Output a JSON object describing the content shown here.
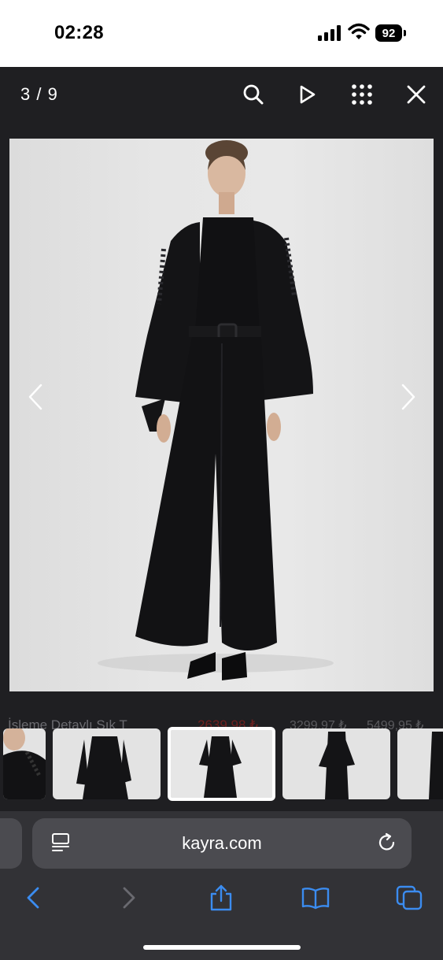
{
  "status_bar": {
    "time": "02:28",
    "battery": "92"
  },
  "gallery": {
    "counter": "3 / 9",
    "icons": [
      "search-icon",
      "play-icon",
      "grid-icon",
      "close-icon",
      "chevron-left-icon",
      "chevron-right-icon"
    ]
  },
  "below_gallery": {
    "title_fragment": "İşleme Detaylı Şık T",
    "sale_price_fragment": "2639,98 ₺",
    "price_a_fragment": "3299,97 ₺",
    "price_b_fragment": "5499,95 ₺"
  },
  "thumbnails": {
    "count": 5,
    "active_index": 2
  },
  "safari": {
    "url": "kayra.com",
    "icons": [
      "reader-icon",
      "reload-icon",
      "back-icon",
      "forward-icon",
      "share-icon",
      "bookmarks-icon",
      "tabs-icon"
    ]
  },
  "colors": {
    "accent": "#3b8cf0",
    "background": "#2a2a2e",
    "garment": "#121214",
    "photo_bg": "#e3e3e3"
  }
}
